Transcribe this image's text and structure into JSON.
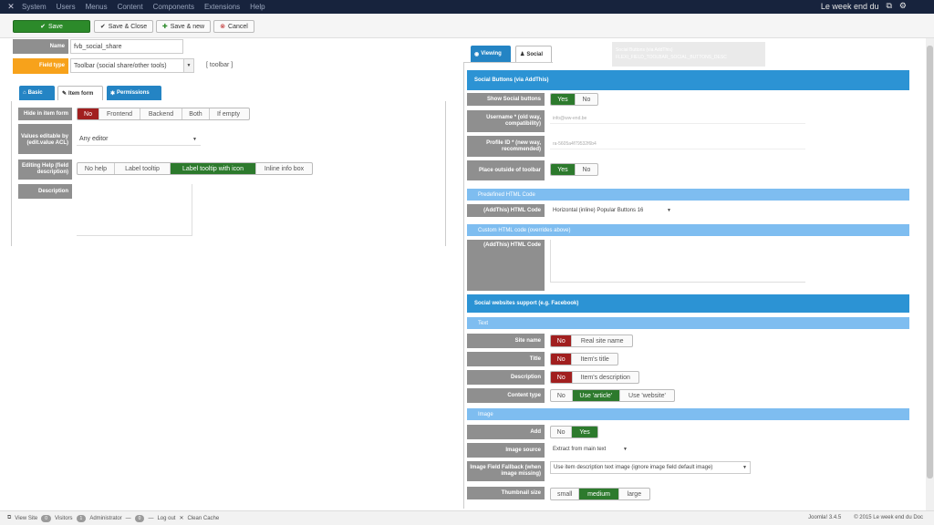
{
  "topnav": {
    "menu": [
      "System",
      "Users",
      "Menus",
      "Content",
      "Components",
      "Extensions",
      "Help"
    ],
    "site_name": "Le week end du"
  },
  "toolbar": {
    "save": "Save",
    "save_close": "Save & Close",
    "save_new": "Save & new",
    "cancel": "Cancel"
  },
  "form": {
    "name_label": "Name",
    "name_value": "fvb_social_share",
    "field_type_label": "Field type",
    "field_type_value": "Toolbar (social share/other tools)",
    "field_type_suffix": "[ toolbar ]"
  },
  "left_tabs": [
    "Basic",
    "Item form",
    "Permissions"
  ],
  "left_rows": {
    "hide_label": "Hide in item form",
    "hide_options": [
      "No",
      "Frontend",
      "Backend",
      "Both",
      "If empty"
    ],
    "editable_label": "Values editable by (edit.value ACL)",
    "editable_value": "Any editor",
    "editing_help_label": "Editing Help (field description)",
    "editing_help_options": [
      "No help",
      "Label tooltip",
      "Label tooltip with icon",
      "Inline info box"
    ],
    "description_label": "Description"
  },
  "right_tabs": [
    "Viewing",
    "Social"
  ],
  "tooltip": {
    "line1": "Social Buttons (via AddThis)",
    "line2": "FLEXI_FIELD_TOOLBAR_SOCIAL_BUTTONS_DESC"
  },
  "right": {
    "head_social": "Social Buttons (via AddThis)",
    "show_social_label": "Show Social buttons",
    "yes": "Yes",
    "no": "No",
    "username_label": "Username * (old way, compatibility)",
    "username_value": "info@ww-end.be",
    "profile_label": "Profile ID * (new way, recommended)",
    "profile_value": "ra-5605a4f79532f6b4",
    "place_outside_label": "Place outside of toolbar",
    "predefined_head": "Predefined HTML Code",
    "addthis_html_label": "(AddThis) HTML Code",
    "addthis_html_value": "Horizontal (inline) Popular Buttons 16",
    "custom_head": "Custom HTML code (overrides above)",
    "custom_html_label": "(AddThis) HTML Code",
    "social_support_head": "Social websites support (e.g. Facebook)",
    "text_head": "Text",
    "site_name_label": "Site name",
    "site_name_alt": "Real site name",
    "title_label": "Title",
    "title_alt": "Item's title",
    "description_label": "Description",
    "description_alt": "Item's description",
    "content_type_label": "Content type",
    "content_type_options": [
      "No",
      "Use 'article'",
      "Use 'website'"
    ],
    "image_head": "Image",
    "add_label": "Add",
    "image_source_label": "Image source",
    "image_source_value": "Extract from main text",
    "image_fallback_label": "Image Field Fallback (when image missing)",
    "image_fallback_value": "Use item description text image (ignore image field default image)",
    "thumbnail_label": "Thumbnail size",
    "thumbnail_options": [
      "small",
      "medium",
      "large"
    ]
  },
  "status": {
    "view_site": "View Site",
    "visitors_count": "0",
    "visitors": "Visitors",
    "admin_count": "1",
    "administrator": "Administrator",
    "msgs_count": "0",
    "logout": "Log out",
    "clean_cache": "Clean Cache",
    "version": "Joomla! 3.4.5",
    "copyright": "© 2015 Le week end du Doc"
  }
}
